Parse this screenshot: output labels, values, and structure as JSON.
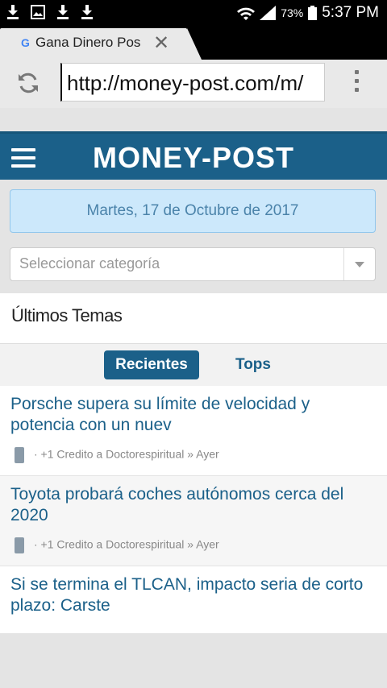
{
  "status_bar": {
    "battery": "73%",
    "time": "5:37 PM"
  },
  "browser": {
    "tab_title": "Gana Dinero Pos",
    "favicon": "G",
    "url": "http://money-post.com/m/"
  },
  "site": {
    "logo": "MONEY-POST",
    "date": "Martes, 17 de Octubre de 2017",
    "category_placeholder": "Seleccionar categoría",
    "section_title": "Últimos Temas",
    "tabs": [
      "Recientes",
      "Tops"
    ],
    "posts": [
      {
        "title": "Porsche supera su límite de velocidad y potencia con un nuev",
        "meta": "· +1 Credito a Doctorespiritual » Ayer"
      },
      {
        "title": "Toyota probará coches autónomos cerca del 2020",
        "meta": "· +1 Credito a Doctorespiritual » Ayer"
      },
      {
        "title": "Si se termina el TLCAN, impacto seria de corto plazo: Carste",
        "meta": ""
      }
    ]
  },
  "colors": {
    "brand": "#1b6089",
    "date_bg": "#cce8fb",
    "link": "#1b6089"
  }
}
